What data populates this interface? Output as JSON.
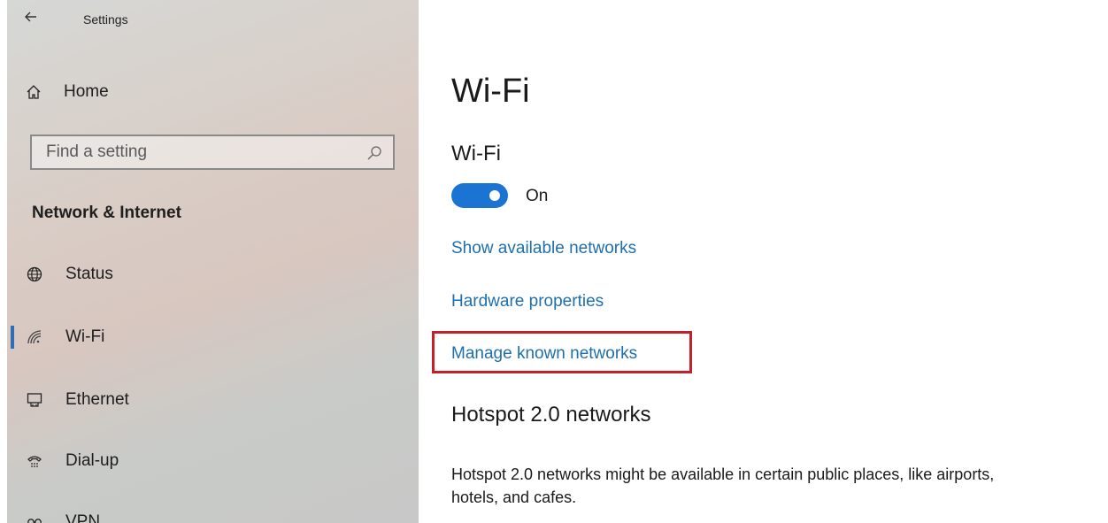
{
  "app": {
    "title": "Settings"
  },
  "sidebar": {
    "home_label": "Home",
    "search_placeholder": "Find a setting",
    "section_title": "Network & Internet",
    "items": [
      {
        "label": "Status",
        "icon": "globe-icon"
      },
      {
        "label": "Wi-Fi",
        "icon": "wifi-icon",
        "selected": true
      },
      {
        "label": "Ethernet",
        "icon": "ethernet-icon"
      },
      {
        "label": "Dial-up",
        "icon": "dialup-icon"
      },
      {
        "label": "VPN",
        "icon": "vpn-icon"
      }
    ]
  },
  "main": {
    "page_title": "Wi-Fi",
    "wifi_section_title": "Wi-Fi",
    "toggle_state": "On",
    "links": {
      "show_networks": "Show available networks",
      "hardware_properties": "Hardware properties",
      "manage_known": "Manage known networks"
    },
    "hotspot_title": "Hotspot 2.0 networks",
    "hotspot_description": "Hotspot 2.0 networks might be available in certain public places, like airports, hotels, and cafes."
  },
  "colors": {
    "accent": "#1b74d2",
    "link": "#1d6fae",
    "highlight_border": "#c4202a"
  }
}
